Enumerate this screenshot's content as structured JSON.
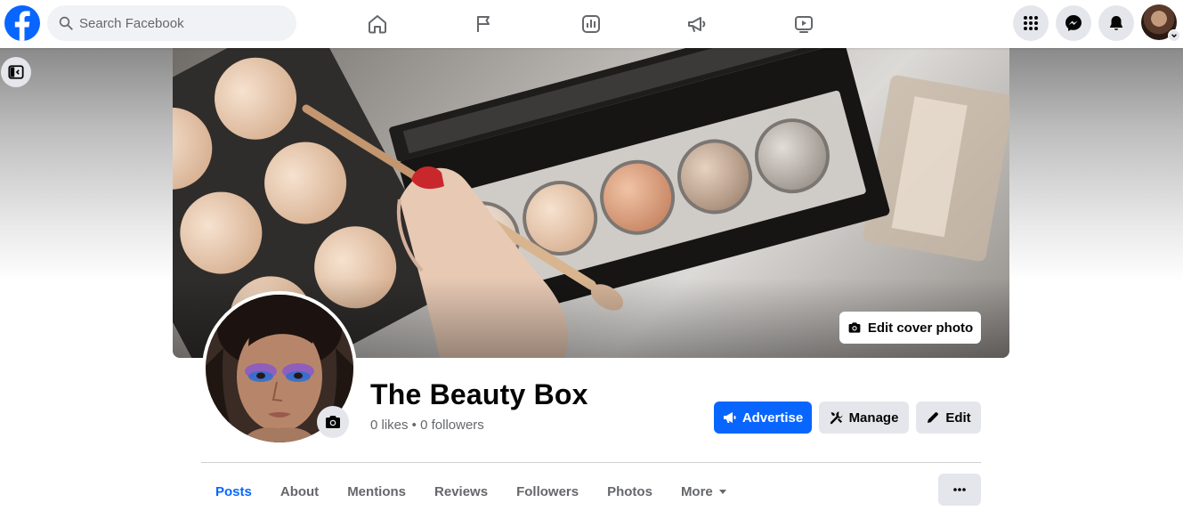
{
  "search": {
    "placeholder": "Search Facebook"
  },
  "nav": {
    "icons": [
      "home-icon",
      "flag-icon",
      "insights-icon",
      "megaphone-icon",
      "video-icon"
    ]
  },
  "header_actions": [
    "menu-grid-icon",
    "messenger-icon",
    "bell-icon"
  ],
  "cover": {
    "edit_label": "Edit cover photo"
  },
  "page": {
    "name": "The Beauty Box",
    "stats": "0 likes • 0 followers"
  },
  "actions": {
    "advertise": "Advertise",
    "manage": "Manage",
    "edit": "Edit"
  },
  "tabs": [
    {
      "label": "Posts",
      "active": true
    },
    {
      "label": "About"
    },
    {
      "label": "Mentions"
    },
    {
      "label": "Reviews"
    },
    {
      "label": "Followers"
    },
    {
      "label": "Photos"
    },
    {
      "label": "More"
    }
  ],
  "colors": {
    "brand": "#0866ff",
    "secondary_button": "#e4e6eb",
    "muted_text": "#65676b"
  }
}
